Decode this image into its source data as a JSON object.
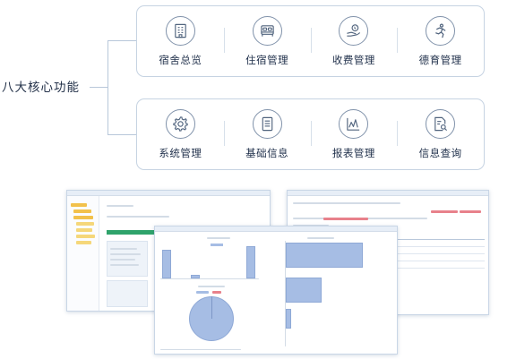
{
  "diagram": {
    "center_label": "八大核心功能",
    "row1": [
      {
        "label": "宿舍总览",
        "icon": "building-icon"
      },
      {
        "label": "住宿管理",
        "icon": "bed-icon"
      },
      {
        "label": "收费管理",
        "icon": "money-icon"
      },
      {
        "label": "德育管理",
        "icon": "person-running-icon"
      }
    ],
    "row2": [
      {
        "label": "系统管理",
        "icon": "gear-icon"
      },
      {
        "label": "基础信息",
        "icon": "list-document-icon"
      },
      {
        "label": "报表管理",
        "icon": "chart-line-icon"
      },
      {
        "label": "信息查询",
        "icon": "document-search-icon"
      }
    ]
  },
  "colors": {
    "line": "#b8c7da",
    "icon_stroke": "#8092aa",
    "panel_border": "#c6d3e2",
    "bar_fill": "#a6bde4",
    "accent_green": "#2fa36b"
  }
}
